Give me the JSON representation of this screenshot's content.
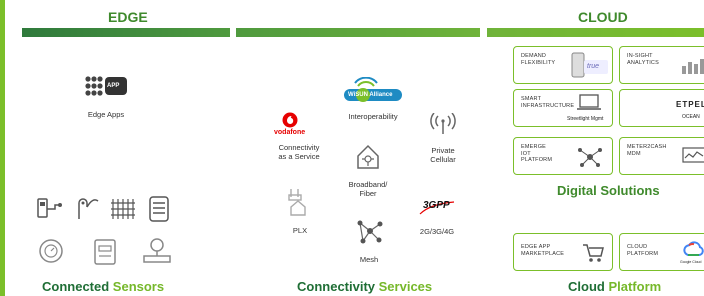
{
  "headers": {
    "edge": "EDGE",
    "cloud": "CLOUD"
  },
  "colors": {
    "accent_green": "#7bbf2a",
    "dark_green": "#1f6e35",
    "band_edge": "#3c8b45",
    "band_cloud": "#5aa83a"
  },
  "edge": {
    "edge_apps_label": "Edge Apps",
    "app_badge": "APP",
    "section_title": {
      "part1": "Connected",
      "part2": "Sensors"
    }
  },
  "connectivity": {
    "vodafone_logo": "vodafone",
    "vodafone_label": "Connectivity\nas a Service",
    "wisun_logo": {
      "wi": "Wi",
      "sun": "SUN",
      "alliance": "Alliance"
    },
    "interop_label": "Interoperability",
    "private_label": "Private\nCellular",
    "broadband_label": "Broadband/\nFiber",
    "plx_label": "PLX",
    "threegpp_logo": "3GPP",
    "cellular_label": "2G/3G/4G",
    "mesh_label": "Mesh",
    "section_title": {
      "part1": "Connectivity",
      "part2": "Services"
    }
  },
  "digital": {
    "cards": [
      {
        "title": "DEMAND\nFLEXIBILITY",
        "brand": "true"
      },
      {
        "title": "IN-SIGHT\nANALYTICS",
        "brand": ""
      },
      {
        "title": "SMART\nINFRASTRUCTURE",
        "brand": "Streetlight Mgmt"
      },
      {
        "title": "",
        "brand": "ETPEL",
        "sub": "OCEAN"
      },
      {
        "title": "EMERGE\nIOT\nPLATFORM",
        "brand": ""
      },
      {
        "title": "METER2CASH\nMDM",
        "brand": ""
      }
    ],
    "section_title": "Digital Solutions"
  },
  "platform": {
    "cards": [
      {
        "title": "EDGE APP\nMARKETPLACE"
      },
      {
        "title": "CLOUD\nPLATFORM",
        "brand": "Google Cloud"
      }
    ],
    "section_title": {
      "part1": "Cloud",
      "part2": "Platform"
    }
  }
}
